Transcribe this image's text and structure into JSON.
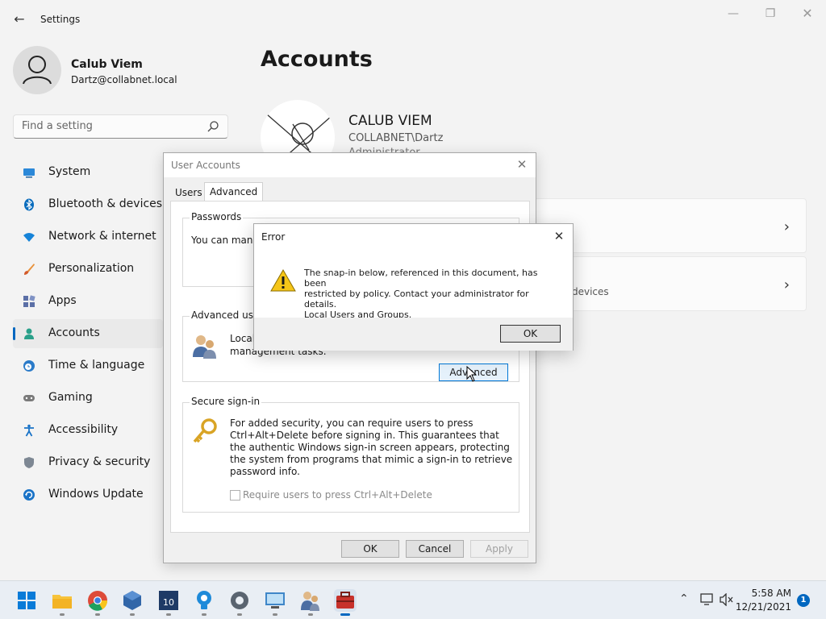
{
  "window": {
    "title": "Settings"
  },
  "user": {
    "name": "Calub Viem",
    "email": "Dartz@collabnet.local"
  },
  "search": {
    "placeholder": "Find a setting"
  },
  "nav": {
    "items": [
      {
        "label": "System",
        "icon": "monitor-icon"
      },
      {
        "label": "Bluetooth & devices",
        "icon": "bluetooth-icon"
      },
      {
        "label": "Network & internet",
        "icon": "wifi-icon"
      },
      {
        "label": "Personalization",
        "icon": "brush-icon"
      },
      {
        "label": "Apps",
        "icon": "apps-icon"
      },
      {
        "label": "Accounts",
        "icon": "person-icon",
        "selected": true
      },
      {
        "label": "Time & language",
        "icon": "clock-globe-icon"
      },
      {
        "label": "Gaming",
        "icon": "gamepad-icon"
      },
      {
        "label": "Accessibility",
        "icon": "accessibility-icon"
      },
      {
        "label": "Privacy & security",
        "icon": "shield-icon"
      },
      {
        "label": "Windows Update",
        "icon": "update-icon"
      }
    ]
  },
  "main": {
    "title": "Accounts",
    "account": {
      "name": "CALUB VIEM",
      "domain": "COLLABNET\\Dartz",
      "role": "Administrator"
    },
    "card2_text": "devices"
  },
  "user_accounts": {
    "title": "User Accounts",
    "tabs": [
      "Users",
      "Advanced"
    ],
    "active_tab": "Advanced",
    "passwords": {
      "legend": "Passwords",
      "text": "You can manage"
    },
    "advanced_user": {
      "legend": "Advanced user",
      "text_line1": "Local",
      "text_line2": "management tasks.",
      "button": "Advanced"
    },
    "secure_signin": {
      "legend": "Secure sign-in",
      "text": "For added security, you can require users to press Ctrl+Alt+Delete before signing in. This guarantees that the authentic Windows sign-in screen appears, protecting the system from programs that mimic a sign-in to retrieve password info.",
      "checkbox_label": "Require users to press Ctrl+Alt+Delete",
      "checkbox_checked": false
    },
    "buttons": {
      "ok": "OK",
      "cancel": "Cancel",
      "apply": "Apply"
    }
  },
  "error_dialog": {
    "title": "Error",
    "message_line1": "The snap-in below, referenced in this document, has been",
    "message_line2": "restricted by policy. Contact your administrator for details.",
    "message_line3": "Local Users and Groups.",
    "ok": "OK"
  },
  "taskbar": {
    "time": "5:58 AM",
    "date": "12/21/2021",
    "notification_count": "1",
    "apps": [
      "start-icon",
      "file-explorer-icon",
      "chrome-icon",
      "virtualbox-icon",
      "cpu-z-icon",
      "lightbulb-icon",
      "settings-gear-icon",
      "remote-desktop-icon",
      "user-accounts-icon",
      "toolbox-icon"
    ]
  }
}
